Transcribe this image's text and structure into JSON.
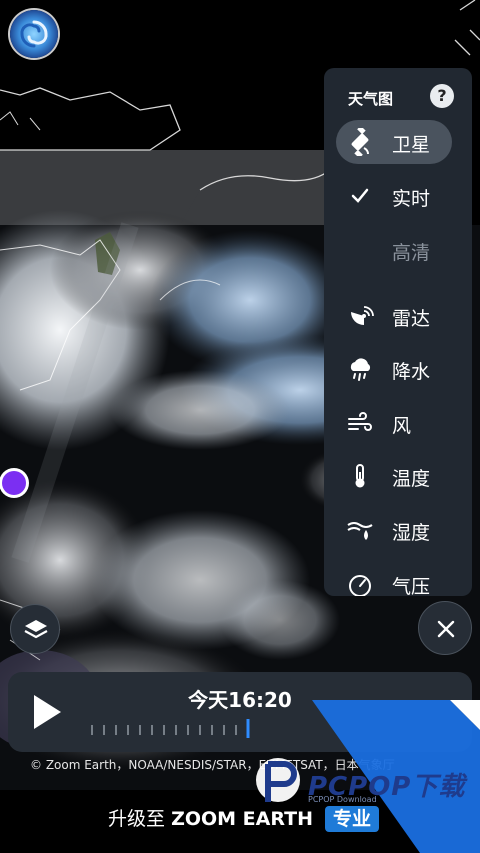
{
  "panel": {
    "title": "天气图",
    "help": "?",
    "items": [
      {
        "label": "卫星",
        "icon": "satellite-icon",
        "active": true
      },
      {
        "label": "实时",
        "icon": "check-icon"
      },
      {
        "label": "高清",
        "icon": "none"
      },
      {
        "label": "雷达",
        "icon": "radar-icon"
      },
      {
        "label": "降水",
        "icon": "precipitation-icon"
      },
      {
        "label": "风",
        "icon": "wind-icon"
      },
      {
        "label": "温度",
        "icon": "thermometer-icon"
      },
      {
        "label": "湿度",
        "icon": "humidity-icon"
      },
      {
        "label": "气压",
        "icon": "pressure-gauge-icon"
      }
    ]
  },
  "timeline": {
    "time": "今天16:20",
    "tick_count": 14,
    "current_tick": 13
  },
  "credits": "© Zoom Earth，NOAA/NESDIS/STAR，EUMETSAT，日本气象厅",
  "upgrade": {
    "prefix": "升级至",
    "brand": "ZOOM EARTH",
    "badge": "专业"
  },
  "watermark": {
    "text": "PCPOP下载",
    "sub": "PCPOP Download"
  },
  "colors": {
    "panel_bg": "#212831",
    "active_item": "#4a535e",
    "accent": "#1f7bd8",
    "location_dot": "#7b2ff2"
  }
}
